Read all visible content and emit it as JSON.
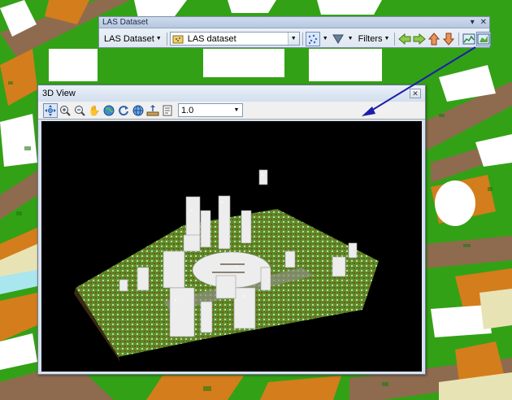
{
  "toolbar": {
    "title": "LAS Dataset",
    "menu_label": "LAS Dataset",
    "layer_combo_value": "LAS dataset",
    "filters_label": "Filters"
  },
  "view_window": {
    "title": "3D View",
    "zoom_combo_value": "1.0"
  },
  "icons": {
    "toolbar": [
      "points-icon",
      "triangle-filter-icon",
      "arrow-left-icon",
      "arrow-right-icon",
      "arrow-up-icon",
      "arrow-down-icon",
      "profile-view-icon",
      "3d-view-icon"
    ],
    "view": [
      "navigate-icon",
      "zoom-in-icon",
      "zoom-out-icon",
      "pan-icon",
      "globe-icon",
      "refresh-icon",
      "full-extent-icon",
      "vertical-exaggeration-icon",
      "properties-icon"
    ]
  },
  "colors": {
    "map_ground": "#33a116",
    "map_vegetation": "#d47d1c",
    "map_building": "#ffffff",
    "map_road": "#8e6b4e",
    "annotation_arrow": "#1a1faa",
    "canvas_bg": "#000000"
  }
}
